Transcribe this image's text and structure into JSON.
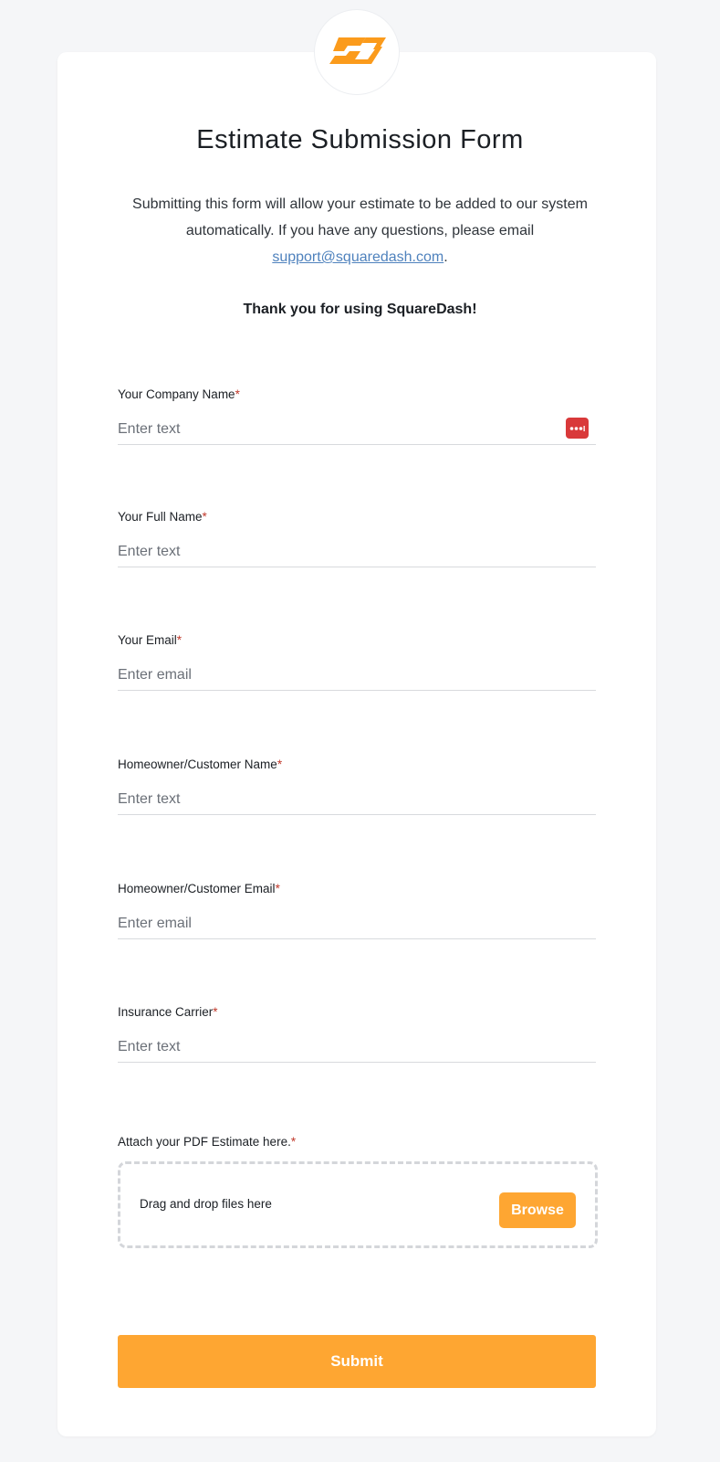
{
  "brand": {
    "logo_icon": "squaredash-logo-icon",
    "accent_color": "#fea632"
  },
  "header": {
    "title": "Estimate Submission Form",
    "intro_text": "Submitting this form will allow your estimate to be added to our system automatically. If you have any questions, please email ",
    "support_email": "support@squaredash.com",
    "intro_suffix": ".",
    "thanks": "Thank you for using SquareDash!"
  },
  "fields": [
    {
      "label": "Your Company Name",
      "required_mark": "*",
      "placeholder": "Enter text",
      "value": ""
    },
    {
      "label": "Your Full Name",
      "required_mark": "*",
      "placeholder": "Enter text",
      "value": ""
    },
    {
      "label": "Your Email",
      "required_mark": "*",
      "placeholder": "Enter email",
      "value": ""
    },
    {
      "label": "Homeowner/Customer Name",
      "required_mark": "*",
      "placeholder": "Enter text",
      "value": ""
    },
    {
      "label": "Homeowner/Customer Email",
      "required_mark": "*",
      "placeholder": "Enter email",
      "value": ""
    },
    {
      "label": "Insurance Carrier",
      "required_mark": "*",
      "placeholder": "Enter text",
      "value": ""
    }
  ],
  "upload": {
    "label": "Attach your PDF Estimate here.",
    "required_mark": "*",
    "drop_text": "Drag and drop files here",
    "browse_label": "Browse"
  },
  "submit_label": "Submit",
  "password_manager_icon": "password-manager-icon"
}
